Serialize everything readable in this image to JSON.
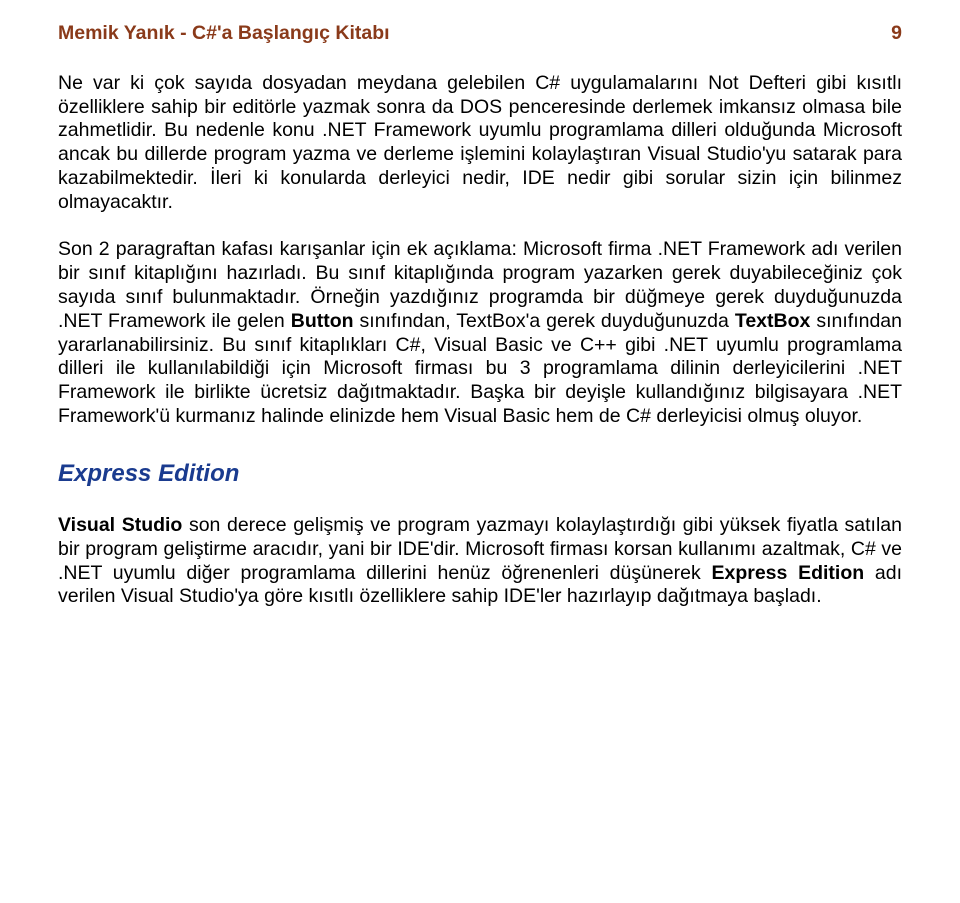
{
  "header": {
    "title": "Memik Yanık - C#'a Başlangıç Kitabı",
    "page_number": "9"
  },
  "paragraphs": {
    "p1": "Ne var ki çok sayıda dosyadan meydana gelebilen C# uygulamalarını Not Defteri gibi kısıtlı özelliklere sahip bir editörle yazmak sonra da DOS penceresinde derlemek imkansız olmasa bile zahmetlidir. Bu nedenle konu .NET Framework uyumlu programlama dilleri olduğunda Microsoft ancak bu dillerde program yazma ve derleme işlemini kolaylaştıran Visual Studio'yu satarak para kazabilmektedir. İleri ki konularda derleyici nedir, IDE nedir gibi sorular sizin için bilinmez olmayacaktır.",
    "p2_a": "Son 2 paragraftan kafası karışanlar için ek açıklama: Microsoft firma .NET Framework adı verilen bir sınıf kitaplığını hazırladı. Bu sınıf kitaplığında program yazarken gerek duyabileceğiniz çok sayıda sınıf bulunmaktadır. Örneğin yazdığınız programda bir düğmeye gerek duyduğunuzda .NET Framework ile gelen ",
    "p2_button": "Button",
    "p2_b": " sınıfından, TextBox'a gerek duyduğunuzda ",
    "p2_textbox": "TextBox",
    "p2_c": " sınıfından yararlanabilirsiniz. Bu sınıf kitaplıkları C#, Visual Basic ve C++ gibi .NET uyumlu programlama dilleri ile kullanılabildiği için Microsoft firması bu 3 programlama dilinin derleyicilerini .NET Framework ile birlikte ücretsiz dağıtmaktadır. Başka bir deyişle kullandığınız bilgisayara .NET Framework'ü kurmanız halinde elinizde hem Visual Basic hem de C# derleyicisi olmuş oluyor.",
    "heading": "Express Edition",
    "p3_vs": "Visual Studio",
    "p3_a": " son derece gelişmiş ve program yazmayı kolaylaştırdığı gibi yüksek fiyatla satılan bir program geliştirme aracıdır, yani bir IDE'dir. Microsoft firması korsan kullanımı azaltmak, C# ve .NET uyumlu diğer programlama dillerini henüz öğrenenleri düşünerek ",
    "p3_ee": "Express Edition",
    "p3_b": " adı verilen Visual Studio'ya göre kısıtlı özelliklere sahip IDE'ler hazırlayıp dağıtmaya başladı."
  }
}
